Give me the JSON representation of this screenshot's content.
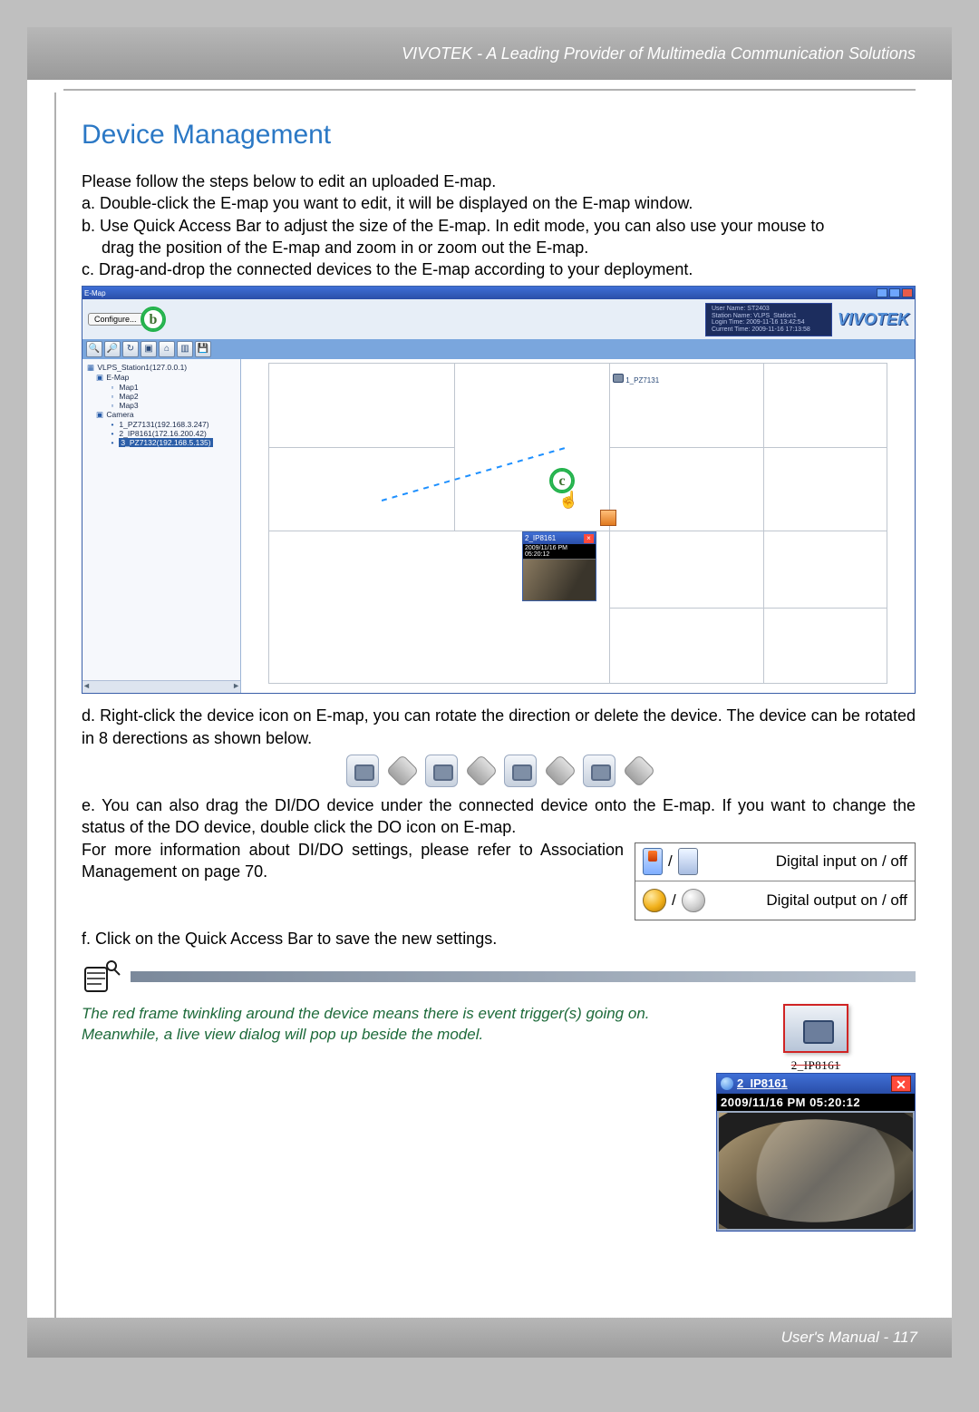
{
  "header": {
    "tagline": "VIVOTEK - A Leading Provider of Multimedia Communication Solutions"
  },
  "title": "Device Management",
  "intro": "Please follow the steps below to edit an uploaded E-map.",
  "steps": {
    "a": "a. Double-click the E-map you want to edit, it will be displayed on the E-map window.",
    "b": "b. Use Quick Access Bar to adjust the size of the E-map. In edit mode, you can also use your mouse to",
    "b_cont": "drag the position of the E-map and zoom in or zoom out the E-map.",
    "c": "c. Drag-and-drop the connected devices to the E-map according to your deployment.",
    "d": "d. Right-click the device icon on E-map, you can rotate the direction or delete the device. The device can be rotated in 8 derections as shown below.",
    "e": "e. You can also drag the DI/DO device under the connected device onto the E-map. If you want to change the status of the DO device, double click the DO icon on E-map.",
    "e_more": "For more information about DI/DO settings, please refer to Association Management on page 70.",
    "f": "f. Click        on the Quick Access Bar to save the new settings."
  },
  "app": {
    "title": "E-Map",
    "config_btn": "Configure...",
    "logo": "VIVOTEK",
    "session": {
      "l1": "User Name: ST2403",
      "l2": "Station Name: VLPS_Station1",
      "l3": "Login Time: 2009-11-16 13:42:54",
      "l4": "Current Time: 2009-11-16 17:13:58"
    },
    "tree": {
      "root": "VLPS_Station1(127.0.0.1)",
      "emap_folder": "E-Map",
      "map1": "Map1",
      "map2": "Map2",
      "map3": "Map3",
      "camera_folder": "Camera",
      "cam1": "1_PZ7131(192.168.3.247)",
      "cam2": "2_IP8161(172.16.200.42)",
      "cam3": "3_PZ7132(192.168.5.135)"
    },
    "map_label": "1_PZ7131",
    "popup": {
      "title": "2_IP8161",
      "time": "2009/11/16 PM 05:20:12"
    },
    "callouts": {
      "b": "b",
      "c": "c"
    }
  },
  "io": {
    "slash": " / ",
    "di": "Digital input on / off",
    "do": "Digital output on / off"
  },
  "note": {
    "l1": "The red frame twinkling around the device means there is event trigger(s) going on.",
    "l2": "Meanwhile, a live view dialog will pop up beside the model."
  },
  "live_figure": {
    "label": "2_IP8161",
    "popup_title": "2_IP8161",
    "popup_time": "2009/11/16 PM 05:20:12"
  },
  "footer": {
    "label": "User's Manual - ",
    "page": "117"
  }
}
